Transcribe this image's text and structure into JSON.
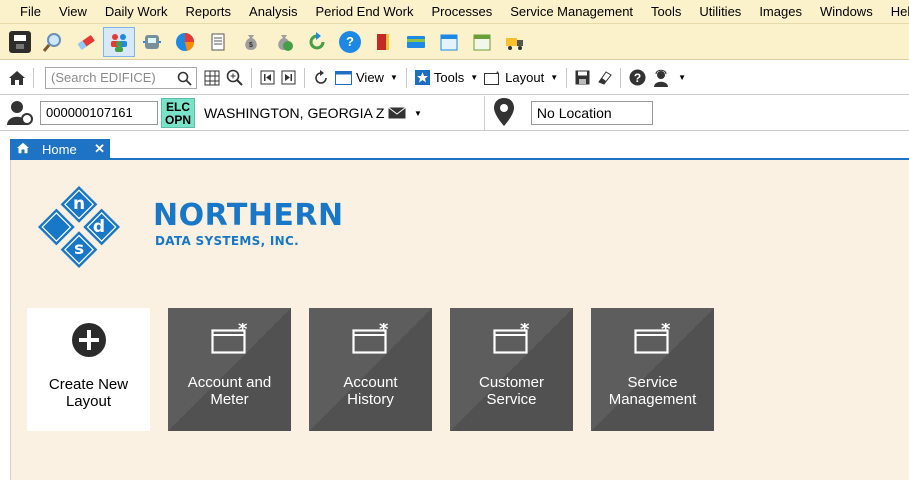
{
  "menu": {
    "items": [
      "File",
      "View",
      "Daily Work",
      "Reports",
      "Analysis",
      "Period End Work",
      "Processes",
      "Service Management",
      "Tools",
      "Utilities",
      "Images",
      "Windows",
      "Help"
    ]
  },
  "toolbar": {
    "icons": [
      "save-icon",
      "magnifier-icon",
      "eraser-icon",
      "customers-icon",
      "meter-icon",
      "chart-icon",
      "document-icon",
      "money-bag-icon",
      "money-bag-green-icon",
      "refresh-icon",
      "help-icon",
      "book-icon",
      "card-icon",
      "calendar-icon",
      "schedule-icon",
      "truck-icon"
    ]
  },
  "search": {
    "placeholder": "(Search EDIFICE)",
    "view_label": "View",
    "tools_label": "Tools",
    "layout_label": "Layout"
  },
  "customer": {
    "account_number": "000000107161",
    "status_line1": "ELC",
    "status_line2": "OPN",
    "name": "WASHINGTON, GEORGIA Z",
    "location": "No Location"
  },
  "tabs": {
    "home_label": "Home",
    "close_glyph": "✕"
  },
  "logo": {
    "line1": "NORTHERN",
    "line2": "DATA SYSTEMS, INC.",
    "letters": [
      "n",
      "d",
      "s"
    ]
  },
  "tiles": {
    "create_line1": "Create New",
    "create_line2": "Layout",
    "t1_line1": "Account and",
    "t1_line2": "Meter",
    "t2_line1": "Account",
    "t2_line2": "History",
    "t3_line1": "Customer",
    "t3_line2": "Service",
    "t4_line1": "Service",
    "t4_line2": "Management"
  },
  "colors": {
    "menu_bg": "#fbf2cc",
    "accent_blue": "#1f73c4",
    "status_badge": "#78e3c8",
    "content_bg": "#fbf1e3",
    "tile_dark": "#515151",
    "logo_blue": "#1877c6"
  }
}
